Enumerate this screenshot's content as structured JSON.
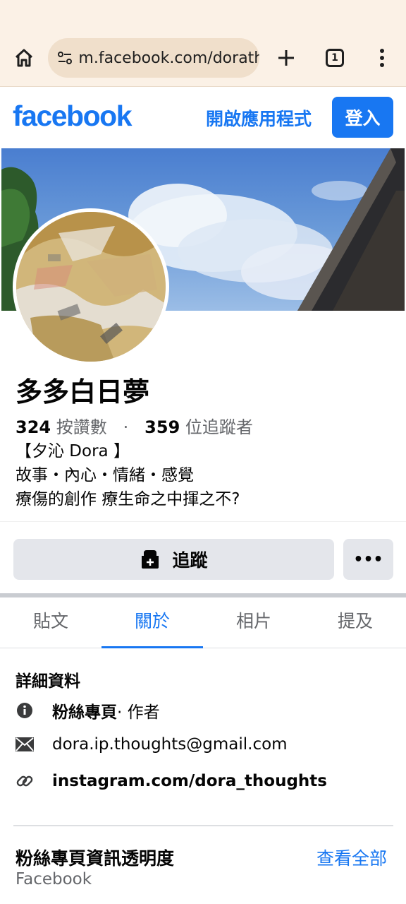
{
  "browser": {
    "url": "m.facebook.com/dorath",
    "tab_count": "1",
    "icons": [
      "home-icon",
      "site-settings-icon",
      "plus-icon",
      "tabs-icon",
      "more-vert-icon"
    ]
  },
  "header": {
    "logo": "facebook",
    "open_app": "開啟應用程式",
    "login": "登入"
  },
  "profile": {
    "name": "多多白日夢",
    "likes_count": "324",
    "likes_label": "按讚數",
    "dot": "·",
    "followers_count": "359",
    "followers_label": "位追蹤者",
    "bio_line1": "【夕沁 Dora 】",
    "bio_line2": "故事・內心・情緒・感覺",
    "bio_line3": "療傷的創作 療生命之中揮之不?"
  },
  "actions": {
    "follow": "追蹤",
    "more": "•••"
  },
  "tabs": [
    {
      "label": "貼文"
    },
    {
      "label": "關於",
      "active": true
    },
    {
      "label": "相片"
    },
    {
      "label": "提及"
    }
  ],
  "details": {
    "title": "詳細資料",
    "page_type_bold": "粉絲專頁",
    "page_type_rest": " · 作者",
    "email": "dora.ip.thoughts@gmail.com",
    "link": "instagram.com/dora_thoughts"
  },
  "transparency": {
    "title": "粉絲專頁資訊透明度",
    "see_all": "查看全部",
    "subtitle": "Facebook"
  },
  "colors": {
    "brand": "#1877f2",
    "chrome_bg": "#fbf1e6",
    "button_gray": "#e4e6eb"
  }
}
